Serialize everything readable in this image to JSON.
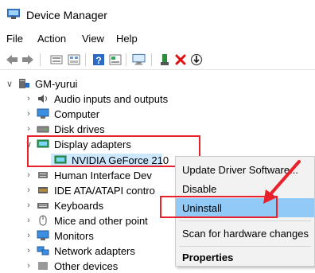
{
  "window": {
    "title": "Device Manager"
  },
  "menu": [
    "File",
    "Action",
    "View",
    "Help"
  ],
  "toolbar_icons": [
    "back-icon",
    "forward-icon",
    "computer-properties-icon",
    "show-hidden-icon",
    "help-icon",
    "view-icon",
    "monitor-icon",
    "update-driver-icon",
    "uninstall-x-icon",
    "scan-icon"
  ],
  "tree": {
    "root": "GM-yurui",
    "items": [
      {
        "label": "Audio inputs and outputs",
        "icon": "speaker-icon"
      },
      {
        "label": "Computer",
        "icon": "computer-icon"
      },
      {
        "label": "Disk drives",
        "icon": "disk-icon"
      },
      {
        "label": "Display adapters",
        "icon": "display-adapter-icon",
        "expanded": true
      },
      {
        "label": "NVIDIA GeForce 210",
        "icon": "display-device-icon",
        "child": true
      },
      {
        "label": "Human Interface Dev",
        "icon": "hid-icon"
      },
      {
        "label": "IDE ATA/ATAPI contro",
        "icon": "ide-icon"
      },
      {
        "label": "Keyboards",
        "icon": "keyboard-icon"
      },
      {
        "label": "Mice and other point",
        "icon": "mouse-icon"
      },
      {
        "label": "Monitors",
        "icon": "monitor-icon"
      },
      {
        "label": "Network adapters",
        "icon": "network-icon"
      },
      {
        "label": "Other devices",
        "icon": "other-devices-icon"
      }
    ]
  },
  "context_menu": {
    "items": [
      "Update Driver Software...",
      "Disable",
      "Uninstall",
      "Scan for hardware changes",
      "Properties"
    ],
    "highlighted": "Uninstall"
  },
  "colors": {
    "annotation": "#e8212b",
    "selection": "#cce8ff",
    "menu_highlight": "#91c9f7"
  }
}
